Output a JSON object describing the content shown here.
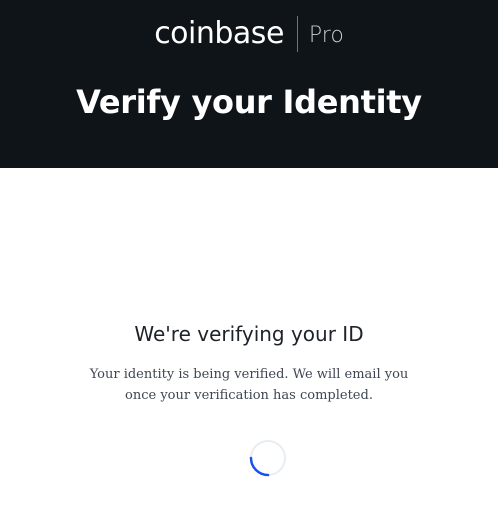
{
  "header": {
    "brand": "coinbase",
    "brand_sub": "Pro",
    "title": "Verify your Identity"
  },
  "main": {
    "heading": "We're verifying your ID",
    "message": "Your identity is being verified. We will email you once your verification has completed."
  },
  "spinner": {
    "icon": "loading-spinner-icon",
    "track_color": "#e8edf2",
    "arc_color": "#1652f0"
  },
  "colors": {
    "header_bg": "#0f1419",
    "header_text": "#ffffff",
    "body_bg": "#ffffff",
    "heading_text": "#1e2329",
    "message_text": "#3d4652"
  }
}
